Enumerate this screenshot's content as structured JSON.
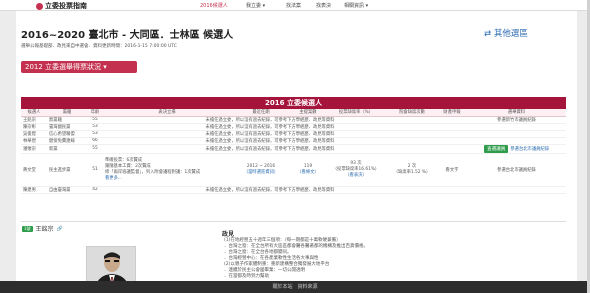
{
  "navbar": {
    "brand": "立委投票指南",
    "items": [
      "2016候選人",
      "我立委 ▾",
      "找法案",
      "找表決",
      "相關資訊 ▾"
    ]
  },
  "header": {
    "title": "2016~2020 臺北市 - 大同區．士林區 候選人",
    "subtitle": "選舉公報基礎部．政見來自中選會．資料更新時間：2016-1-15 7:00:00 UTC",
    "other_link": "其他選區"
  },
  "selector": {
    "label": "2012 立委選舉得票狀況 ▾"
  },
  "section_title": "2016 立委候選人",
  "table": {
    "columns": [
      "候選人",
      "黨籍",
      "年齡",
      "表決立場",
      "最近任期",
      "主提案數",
      "投票缺席率（%）",
      "院會缺席次數",
      "財產申報",
      "選舉資料"
    ],
    "rows": [
      {
        "name": "王銘宗",
        "party": "無黨籍",
        "age": "55",
        "stance": "未擔任過立委，所以沒有過去紀錄，可參考下方學經歷、政見等資料",
        "term": "",
        "bills": "",
        "absent_rate": "",
        "absent_count": "",
        "property": "",
        "records": "參選新竹市議員紀錄"
      },
      {
        "name": "陳宗彰",
        "party": "臺灣國民黨",
        "age": "53",
        "stance": "未擔任過立委，所以沒有過去紀錄，可參考下方學經歷、政見等資料",
        "term": "",
        "bills": "",
        "absent_rate": "",
        "absent_count": "",
        "property": "",
        "records": ""
      },
      {
        "name": "吳俊煌",
        "party": "信心希望聯盟",
        "age": "53",
        "stance": "未擔任過立委，所以沒有過去紀錄，可參考下方學經歷、政見等資料",
        "term": "",
        "bills": "",
        "absent_rate": "",
        "absent_count": "",
        "property": "",
        "records": ""
      },
      {
        "name": "林華煜",
        "party": "健保免費連線",
        "age": "66",
        "stance": "未擔任過立委，所以沒有過去紀錄，可參考下方學經歷、政見等資料",
        "term": "",
        "bills": "",
        "absent_rate": "",
        "absent_count": "",
        "property": "",
        "records": ""
      },
      {
        "name": "潘懷宗",
        "party": "新黨",
        "age": "55",
        "stance": "未擔任過立委，所以沒有過去紀錄，可參考下方學經歷、政見等資料",
        "term": "",
        "bills": "",
        "absent_rate": "",
        "absent_count": "",
        "property": "",
        "records": "參選台北市議員紀錄",
        "button": "查選議員"
      }
    ],
    "incumbent": {
      "name": "蔣文堂",
      "party": "民主進步黨",
      "age": "51",
      "stance_lines": [
        "準確投票：6次贊成",
        "跟隨基本工資：2次贊成",
        "修「兩岸協議監督」，列入附會議程附議：1次贊成",
        "看更多..."
      ],
      "term_lines": [
        "2012 ~ 2016",
        "（當時選區資訊）"
      ],
      "bills_lines": [
        "119",
        "（看條文）"
      ],
      "rate_lines": [
        "93 次",
        "（投票缺席率16.61%）",
        "（看表決）"
      ],
      "count_lines": [
        "2 次",
        "（缺席率1.52 %）"
      ],
      "property": "看文字",
      "records": "參選台北市議員紀錄"
    },
    "last": {
      "name": "陳建男",
      "party": "自由臺灣黨",
      "age": "42",
      "stance": "未擔任過立委，所以沒有過去紀錄，可參考下方學經歷、政見等資料"
    }
  },
  "profile": {
    "badge": "1號",
    "name": "王銘宗",
    "platform_title": "政見",
    "platform": [
      "(1)在地經營五十週年三個項：（每一期都是十萬軟硬兼備）",
      "．台灣之窗：在全台所有大區區都會醫各醫著都的機構及推出百貨價格。",
      "．台灣之窗：在全台各地都變同。",
      "．台灣經營中心：在各產業軟性生活各大事與性",
      "(2)以親子作家體制重：重新建構整合獨發展大地平台",
      "．連續於民主公會國畢業：一切公開透明",
      "．在當都及時到力幫助"
    ]
  },
  "footer": "關於本站　資料來源"
}
